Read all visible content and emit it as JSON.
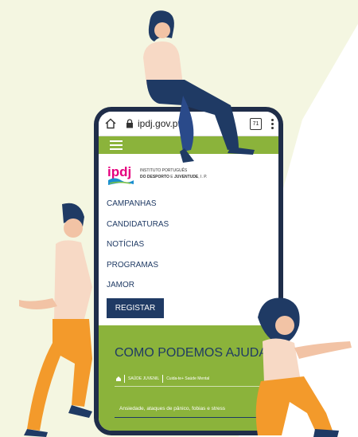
{
  "browser": {
    "url": "ipdj.gov.pt",
    "tab_count": "71"
  },
  "site": {
    "logo_text": "ipdj",
    "org_line1": "INSTITUTO PORTUGUÊS",
    "org_line2_bold1": "DO DESPORTO",
    "org_line2_mid": "E",
    "org_line2_bold2": "JUVENTUDE",
    "org_line2_end": ", I. P."
  },
  "nav": {
    "items": [
      {
        "label": "CAMPANHAS"
      },
      {
        "label": "CANDIDATURAS"
      },
      {
        "label": "NOTÍCIAS"
      },
      {
        "label": "PROGRAMAS"
      },
      {
        "label": "JAMOR"
      }
    ],
    "register_label": "REGISTAR"
  },
  "help": {
    "title": "COMO PODEMOS AJUDAR?",
    "breadcrumb": [
      "SAÚDE JUVENIL",
      "Cuida-te+ Saúde Mental"
    ],
    "topic": "Ansiedade, ataques de pânico, fobias e stress"
  },
  "colors": {
    "green": "#8bb33b",
    "navy": "#1f3a64",
    "phone_frame": "#1f2d49",
    "orange": "#f39a2b",
    "background": "#f4f6e1"
  }
}
